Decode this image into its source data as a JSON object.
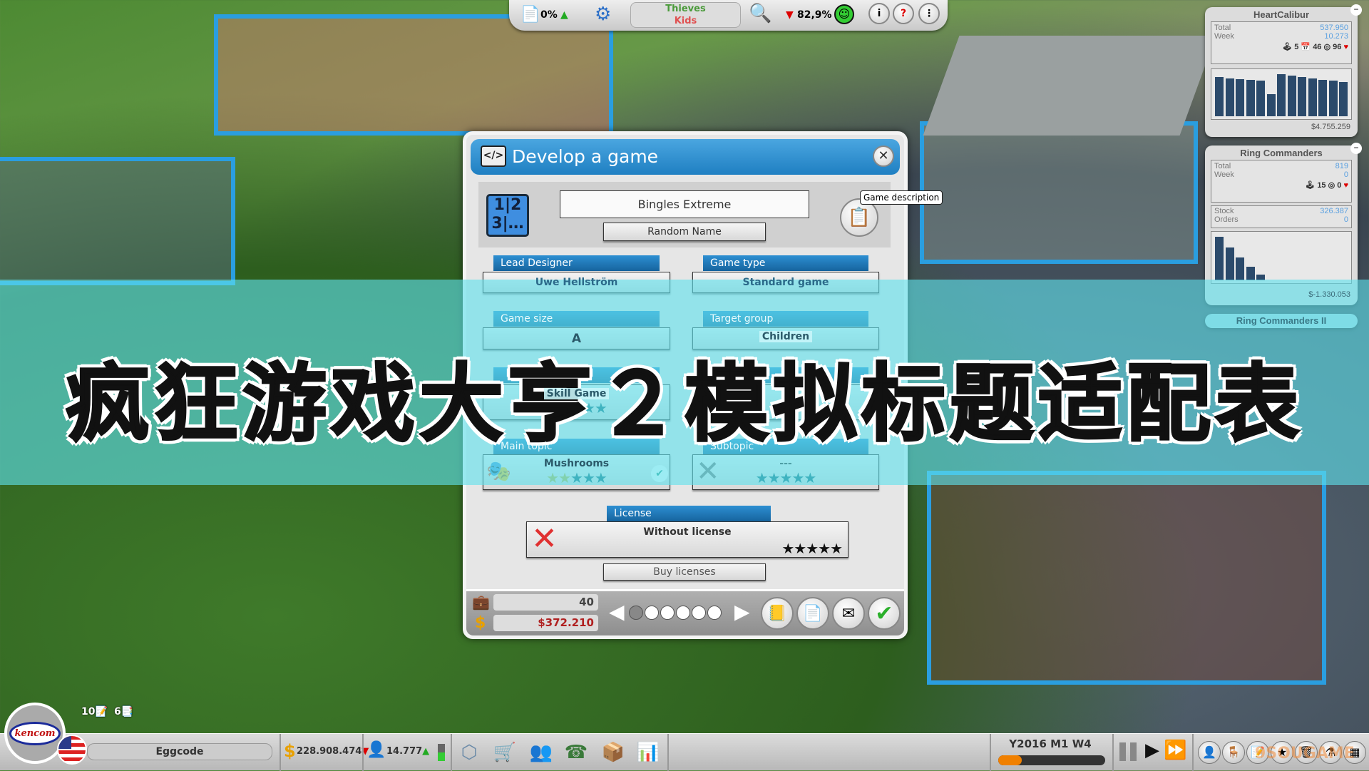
{
  "topbar": {
    "hype_percent": "0%",
    "hype_trend": "▲",
    "genre": "Thieves",
    "target": "Kids",
    "rating_trend": "▼",
    "rating": "82,9%"
  },
  "side_panels": [
    {
      "title": "HeartCalibur",
      "total_label": "Total",
      "total": "537.950",
      "week_label": "Week",
      "week": "10.273",
      "weeks": "5",
      "score": "46",
      "fans": "96",
      "bars": [
        0.88,
        0.85,
        0.84,
        0.82,
        0.8,
        0.5,
        0.95,
        0.92,
        0.88,
        0.85,
        0.83,
        0.8,
        0.77
      ],
      "money": "$4.755.259"
    },
    {
      "title": "Ring Commanders",
      "total_label": "Total",
      "total": "819",
      "week_label": "Week",
      "week": "0",
      "score": "15",
      "fans": "0",
      "stock_label": "Stock",
      "stock": "326.387",
      "orders_label": "Orders",
      "orders": "0",
      "bars": [
        0.95,
        0.72,
        0.5,
        0.3,
        0.12
      ],
      "money": "$-1.330.053"
    },
    {
      "title": "Ring Commanders II"
    }
  ],
  "dialog": {
    "title": "Develop a game",
    "name_value": "Bingles Extreme",
    "random_name": "Random Name",
    "tooltip": "Game description",
    "fields": {
      "lead_designer": {
        "label": "Lead Designer",
        "value": "Uwe Hellström"
      },
      "game_type": {
        "label": "Game type",
        "value": "Standard game"
      },
      "game_size": {
        "label": "Game size",
        "value": "A"
      },
      "target_group": {
        "label": "Target group",
        "value": "Children"
      },
      "genre": {
        "value": "Skill Game",
        "stars": "★★★★★",
        "rating": 2
      },
      "main_topic": {
        "label": "Main topic",
        "value": "Mushrooms",
        "stars": "★★★★★",
        "rating": 2
      },
      "subtopic": {
        "label": "Subtopic",
        "value": "---",
        "stars": "★★★★★",
        "rating": 0
      }
    },
    "license": {
      "label": "License",
      "value": "Without license",
      "stars": "★★★★★"
    },
    "buy_licenses": "Buy licenses",
    "footer": {
      "work": "40",
      "cost": "$372.210",
      "page": 1,
      "pages": 6
    }
  },
  "overlay_title": "疯狂游戏大亨２模拟标题适配表",
  "bottombar": {
    "company_logo": "kencom",
    "company": "Eggcode",
    "money": "228.908.474",
    "money_trend": "▼",
    "fans": "14.777",
    "fans_trend": "▲",
    "tasks_done": "10",
    "tasks_pending": "6",
    "date": "Y2016 M1 W4",
    "week_progress": 0.22
  },
  "watermark": "9SOUGAME",
  "colors": {
    "dialog_header": "#1f7fc2",
    "cost_red": "#b02020",
    "overlay": "#5fe1eb"
  }
}
